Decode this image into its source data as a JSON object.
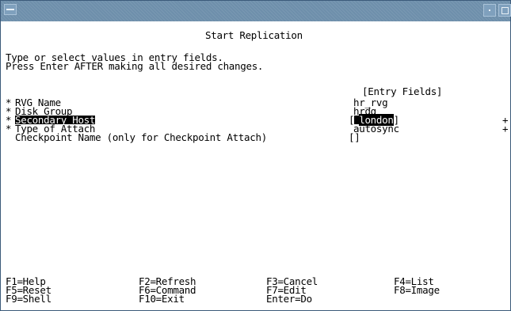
{
  "screen": {
    "title": "Start Replication",
    "instructions": [
      "Type or select values in entry fields.",
      "Press Enter AFTER making all desired changes."
    ],
    "entry_fields_header": "[Entry Fields]",
    "fields": [
      {
        "marker": "*",
        "label": "RVG Name",
        "value": "hr_rvg",
        "indicator": ""
      },
      {
        "marker": "*",
        "label": "Disk Group",
        "value": "hrdg",
        "indicator": ""
      },
      {
        "marker": "*",
        "label": "Secondary Host",
        "value": "london",
        "indicator": "+"
      },
      {
        "marker": "*",
        "label": "Type of Attach",
        "value": "autosync",
        "indicator": "+"
      },
      {
        "marker": "",
        "label": "Checkpoint Name (only for Checkpoint Attach)",
        "value": "[]",
        "indicator": ""
      }
    ],
    "bracket_open": "[",
    "bracket_close": "]"
  },
  "function_keys": [
    [
      "F1=Help",
      "F2=Refresh",
      "F3=Cancel",
      "F4=List"
    ],
    [
      "F5=Reset",
      "F6=Command",
      "F7=Edit",
      "F8=Image"
    ],
    [
      "F9=Shell",
      "F10=Exit",
      "Enter=Do",
      ""
    ]
  ]
}
